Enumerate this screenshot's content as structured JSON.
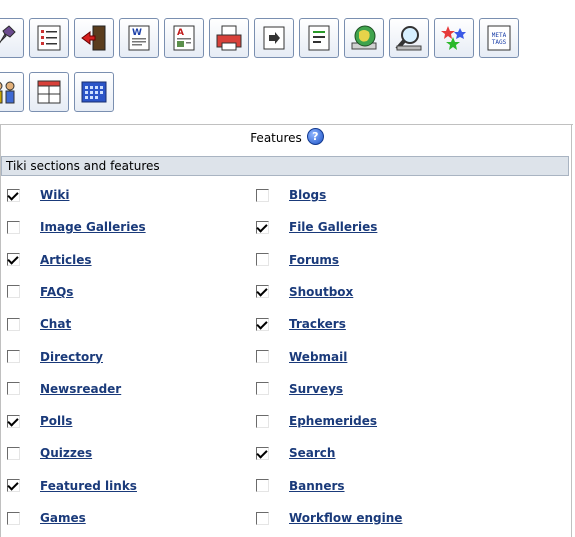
{
  "toolbar": {
    "row1": [
      {
        "icon": "wrench-icon"
      },
      {
        "icon": "list-icon"
      },
      {
        "icon": "login-door-icon"
      },
      {
        "icon": "wiki-page-icon"
      },
      {
        "icon": "article-icon"
      },
      {
        "icon": "printer-icon"
      },
      {
        "icon": "export-icon"
      },
      {
        "icon": "text-lines-icon"
      },
      {
        "icon": "globe-icon"
      },
      {
        "icon": "magnifier-icon"
      },
      {
        "icon": "stars-icon"
      },
      {
        "icon": "meta-tags-icon",
        "label": "META TAGS"
      }
    ],
    "row2": [
      {
        "icon": "users-icon"
      },
      {
        "icon": "layout-grid-icon"
      },
      {
        "icon": "calendar-icon"
      }
    ]
  },
  "panel": {
    "title": "Features",
    "section_header": "Tiki sections and features",
    "features_left": [
      {
        "label": "Wiki",
        "checked": true
      },
      {
        "label": "Image Galleries",
        "checked": false
      },
      {
        "label": "Articles",
        "checked": true
      },
      {
        "label": "FAQs",
        "checked": false
      },
      {
        "label": "Chat",
        "checked": false
      },
      {
        "label": "Directory",
        "checked": false
      },
      {
        "label": "Newsreader",
        "checked": false
      },
      {
        "label": "Polls",
        "checked": true
      },
      {
        "label": "Quizzes",
        "checked": false
      },
      {
        "label": "Featured links",
        "checked": true
      },
      {
        "label": "Games",
        "checked": false
      }
    ],
    "features_right": [
      {
        "label": "Blogs",
        "checked": false
      },
      {
        "label": "File Galleries",
        "checked": true
      },
      {
        "label": "Forums",
        "checked": false
      },
      {
        "label": "Shoutbox",
        "checked": true
      },
      {
        "label": "Trackers",
        "checked": true
      },
      {
        "label": "Webmail",
        "checked": false
      },
      {
        "label": "Surveys",
        "checked": false
      },
      {
        "label": "Ephemerides",
        "checked": false
      },
      {
        "label": "Search",
        "checked": true
      },
      {
        "label": "Banners",
        "checked": false
      },
      {
        "label": "Workflow engine",
        "checked": false
      }
    ]
  }
}
